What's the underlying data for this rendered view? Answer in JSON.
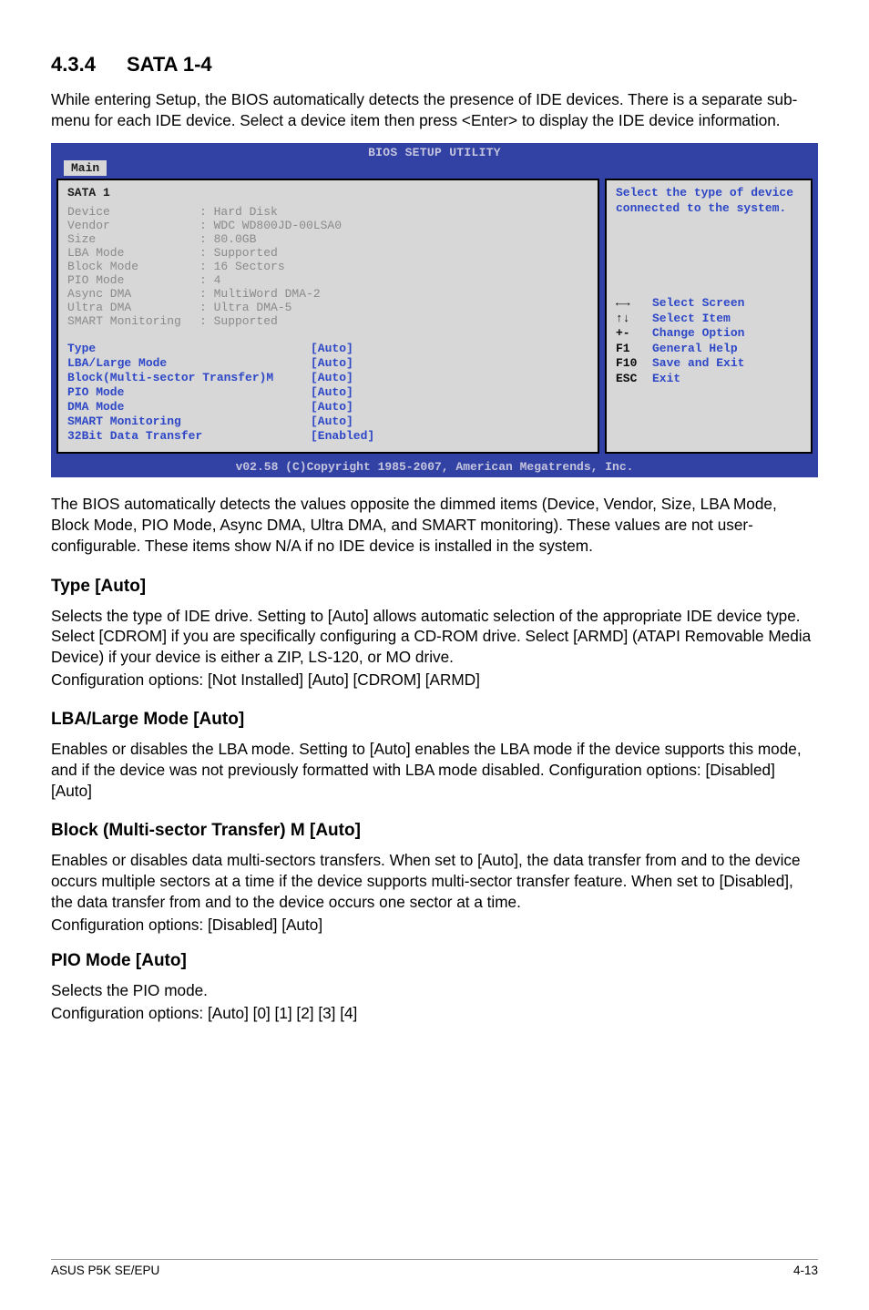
{
  "section": {
    "number": "4.3.4",
    "title": "SATA 1-4"
  },
  "intro": "While entering Setup, the BIOS automatically detects the presence of IDE devices. There is a separate sub-menu for each IDE device. Select a device item then press <Enter> to display the IDE device information.",
  "bios": {
    "title": "BIOS SETUP UTILITY",
    "tab": "Main",
    "panel_header": "SATA 1",
    "dimmed": [
      {
        "label": "Device",
        "value": ": Hard Disk"
      },
      {
        "label": "Vendor",
        "value": ": WDC WD800JD-00LSA0"
      },
      {
        "label": "Size",
        "value": ": 80.0GB"
      },
      {
        "label": "LBA Mode",
        "value": ": Supported"
      },
      {
        "label": "Block Mode",
        "value": ": 16 Sectors"
      },
      {
        "label": "PIO Mode",
        "value": ": 4"
      },
      {
        "label": "Async DMA",
        "value": ": MultiWord DMA-2"
      },
      {
        "label": "Ultra DMA",
        "value": ": Ultra DMA-5"
      },
      {
        "label": "SMART Monitoring",
        "value": ": Supported"
      }
    ],
    "config": [
      {
        "label": "Type",
        "value": "[Auto]"
      },
      {
        "label": "LBA/Large Mode",
        "value": "[Auto]"
      },
      {
        "label": "Block(Multi-sector Transfer)M",
        "value": "[Auto]"
      },
      {
        "label": "PIO Mode",
        "value": "[Auto]"
      },
      {
        "label": "DMA Mode",
        "value": "[Auto]"
      },
      {
        "label": "SMART Monitoring",
        "value": "[Auto]"
      },
      {
        "label": "32Bit Data Transfer",
        "value": "[Enabled]"
      }
    ],
    "help": "Select the type of device connected to the system.",
    "legend": [
      {
        "key": "←→",
        "text": "Select Screen"
      },
      {
        "key": "↑↓",
        "text": "Select Item"
      },
      {
        "key": "+-",
        "text": "Change Option"
      },
      {
        "key": "F1",
        "text": "General Help"
      },
      {
        "key": "F10",
        "text": "Save and Exit"
      },
      {
        "key": "ESC",
        "text": "Exit"
      }
    ],
    "footer": "v02.58 (C)Copyright 1985-2007, American Megatrends, Inc."
  },
  "para_after_bios": "The BIOS automatically detects the values opposite the dimmed items (Device, Vendor, Size, LBA Mode, Block Mode, PIO Mode, Async DMA, Ultra DMA, and SMART monitoring). These values are not user-configurable. These items show N/A if no IDE device is installed in the system.",
  "type": {
    "heading": "Type [Auto]",
    "body": "Selects the type of IDE drive. Setting to [Auto] allows automatic selection of the appropriate IDE device type. Select [CDROM] if you are specifically configuring a CD-ROM drive. Select [ARMD] (ATAPI Removable Media Device) if your device is either a ZIP, LS-120, or MO drive.",
    "opts": "Configuration options: [Not Installed] [Auto] [CDROM] [ARMD]"
  },
  "lba": {
    "heading": "LBA/Large Mode [Auto]",
    "body": "Enables or disables the LBA mode. Setting to [Auto] enables the LBA mode if the device supports this mode, and if the device was not previously formatted with LBA mode disabled. Configuration options: [Disabled] [Auto]"
  },
  "block": {
    "heading": "Block (Multi-sector Transfer) M [Auto]",
    "body": "Enables or disables data multi-sectors transfers. When set to [Auto], the data transfer from and to the device occurs multiple sectors at a time if the device supports multi-sector transfer feature. When set to [Disabled], the data transfer from and to the device occurs one sector at a time.",
    "opts": "Configuration options: [Disabled] [Auto]"
  },
  "pio": {
    "heading": "PIO Mode [Auto]",
    "body": "Selects the PIO mode.",
    "opts": "Configuration options: [Auto] [0] [1] [2] [3] [4]"
  },
  "footer": {
    "left": "ASUS P5K SE/EPU",
    "right": "4-13"
  }
}
